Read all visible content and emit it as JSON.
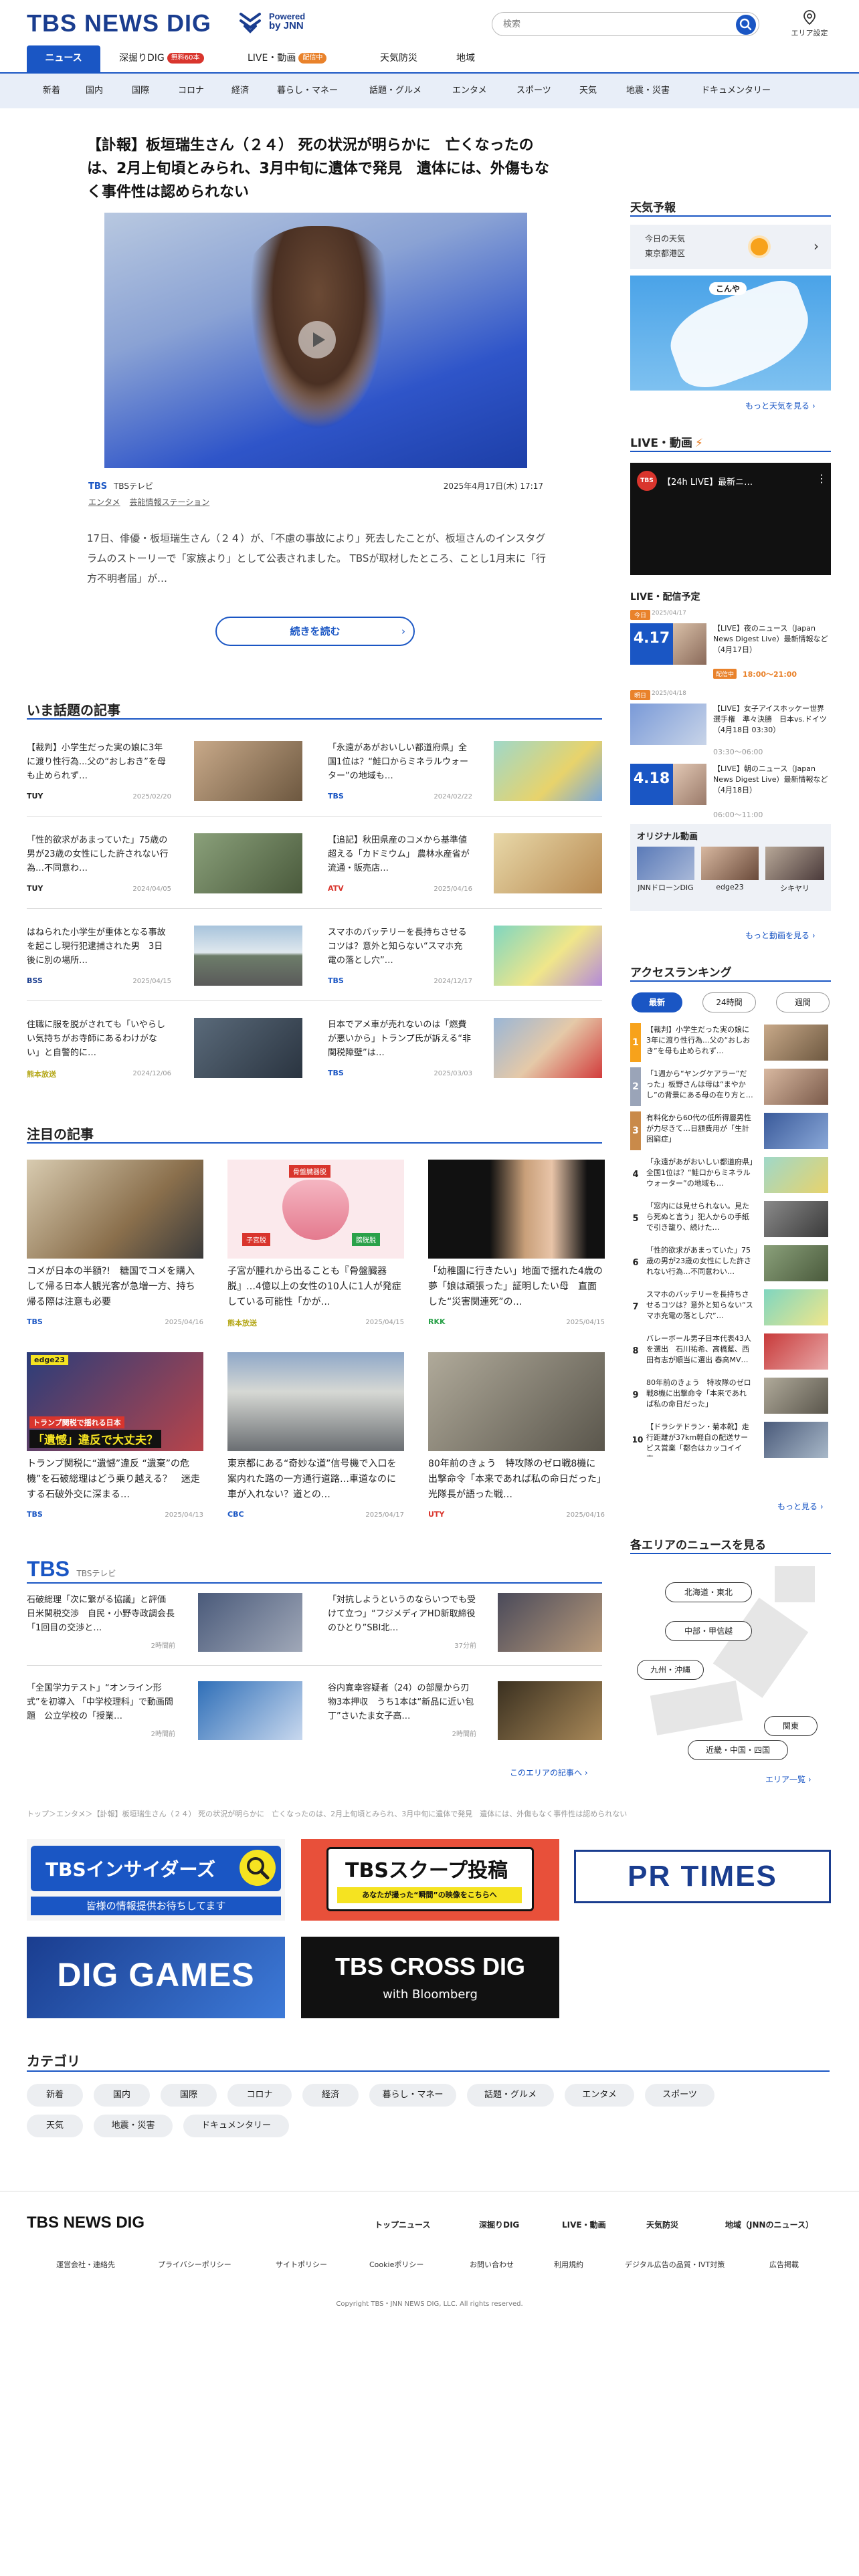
{
  "header": {
    "logo": "TBS NEWS DIG",
    "powered_line1": "Powered",
    "powered_line2": "by JNN",
    "search_placeholder": "検索",
    "area_setting": "エリア設定"
  },
  "nav": {
    "items": [
      {
        "label": "ニュース",
        "badge": ""
      },
      {
        "label": "深掘りDIG",
        "badge": "無料60本"
      },
      {
        "label": "LIVE・動画",
        "badge": "配信中"
      },
      {
        "label": "天気防災",
        "badge": ""
      },
      {
        "label": "地域",
        "badge": ""
      }
    ],
    "badge_colors": {
      "dig": "#d9352d",
      "live": "#e9822b"
    }
  },
  "subnav": [
    "新着",
    "国内",
    "国際",
    "コロナ",
    "経済",
    "暮らし・マネー",
    "話題・グルメ",
    "エンタメ",
    "スポーツ",
    "天気",
    "地震・災害",
    "ドキュメンタリー"
  ],
  "lead": {
    "title": "【訃報】板垣瑞生さん（２４） 死の状況が明らかに　亡くなったのは、2月上旬頃とみられ、3月中旬に遺体で発見　遺体には、外傷もなく事件性は認められない",
    "source_logo": "TBS",
    "source": "TBSテレビ",
    "timestamp": "2025年4月17日(木) 17:17",
    "tag1": "エンタメ",
    "tag2": "芸能情報ステーション",
    "summary": "17日、俳優・板垣瑞生さん（２４）が、「不慮の事故により」死去したことが、板垣さんのインスタグラムのストーリーで「家族より」として公表されました。 TBSが取材したところ、ことし1月末に「行方不明者届」が…",
    "more_label": "続きを読む"
  },
  "topics": {
    "heading": "いま話題の記事",
    "items": [
      {
        "text": "【裁判】小学生だった実の娘に3年に渡り性行為...父の“おしおき”を母も止められず…",
        "source": "TUY",
        "date": "2025/02/20",
        "color": "#222"
      },
      {
        "text": "「永遠があがおいしい都道府県」全国1位は？“鮭口からミネラルウォーター”の地域も…",
        "source": "TBS",
        "date": "2024/02/22",
        "color": "#1a56c4"
      },
      {
        "text": "「性的欲求があまっていた」75歳の男が23歳の女性にした許されない行為…不同意わ…",
        "source": "TUY",
        "date": "2024/04/05",
        "color": "#222"
      },
      {
        "text": "【追記】秋田県産のコメから基準値超える「カドミウム」 農林水産省が流通・販売店…",
        "source": "ATV",
        "date": "2025/04/16",
        "color": "#d9352d"
      },
      {
        "text": "はねられた小学生が重体となる事故を起こし現行犯逮捕された男　3日後に別の場所…",
        "source": "BSS",
        "date": "2025/04/15",
        "color": "#1a3d8f"
      },
      {
        "text": "スマホのバッテリーを長持ちさせるコツは？意外と知らない“スマホ充電の落とし穴”…",
        "source": "TBS",
        "date": "2024/12/17",
        "color": "#1a56c4"
      },
      {
        "text": "住職に服を脱がされても「いやらしい気持ちがお寺師にあるわけがない」と自警的に…",
        "source": "熊本放送",
        "date": "2024/12/06",
        "color": "#b5a81a"
      },
      {
        "text": "日本でアメ車が売れないのは「燃費が悪いから」トランプ氏が訴える“非関税障壁”は…",
        "source": "TBS",
        "date": "2025/03/03",
        "color": "#1a56c4"
      }
    ]
  },
  "featured": {
    "heading": "注目の記事",
    "items": [
      {
        "text": "コメが日本の半額?!　糖国でコメを購入して帰る日本人観光客が急増一方、持ち帰る際は注意も必要",
        "source": "TBS",
        "date": "2025/04/16",
        "color": "#1a56c4"
      },
      {
        "text": "子宮が腫れから出ることも『骨盤臓器脱』…4億以上の女性の10人に1人が発症している可能性「かが…",
        "source": "熊本放送",
        "date": "2025/04/15",
        "color": "#b5a81a"
      },
      {
        "text": "「幼稚園に行きたい」地面で揺れた4歳の夢「娘は頑張った」証明したい母　直面した“災害関連死”の…",
        "source": "RKK",
        "date": "2025/04/15",
        "color": "#2aa14a"
      },
      {
        "text": "トランプ関税に“遺憾”違反 “遺棄”の危機”を石破総理はどう乗り越える？　迷走する石破外交に深まる…",
        "source": "TBS",
        "date": "2025/04/13",
        "color": "#1a56c4"
      },
      {
        "text": "東京都にある“奇妙な道”信号機で入口を案内れた路の一方通行道路…車道なのに車が入れない？道との…",
        "source": "CBC",
        "date": "2025/04/17",
        "color": "#1a56c4"
      },
      {
        "text": "80年前のきょう　特攻隊のゼロ戦8機に出撃命令「本来であれば私の命日だった」光隊長が語った戦…",
        "source": "UTY",
        "date": "2025/04/16",
        "color": "#d9352d"
      }
    ],
    "overlay1": "edge23",
    "overlay2": "トランプ関税で揺れる日本",
    "overlay3": "「遺憾」違反で大丈夫？",
    "overlay4": "子宮脱",
    "overlay5": "膀胱脱",
    "overlay6": "骨盤臓器脱"
  },
  "tbs_block": {
    "heading_logo": "TBS",
    "heading_sub": "TBSテレビ",
    "items": [
      {
        "text": "石破総理「次に繋がる協議」と評価　日米関税交渉　自民・小野寺政調会長「1回目の交渉と…",
        "date": "2時間前"
      },
      {
        "text": "「対抗しようというのならいつでも受けて立つ」“フジメディアHD新取締役のひとり”SBI北…",
        "date": "37分前"
      },
      {
        "text": "「全国学力テスト」“オンライン形式”を初導入 「中学校理科」で動画問題　公立学校の「授業…",
        "date": "2時間前"
      },
      {
        "text": "谷内寛幸容疑者（24）の部屋から刃物3本押収　うち1本は“新品に近い包丁”さいたま女子高…",
        "date": "2時間前"
      }
    ],
    "more": "このエリアの記事へ"
  },
  "breadcrumb": "トップ＞エンタメ＞【訃報】板垣瑞生さん（２４） 死の状況が明らかに　亡くなったのは、2月上旬頃とみられ、3月中旬に遺体で発見　遺体には、外傷もなく事件性は認められない",
  "banners": {
    "insiders_title": "TBSインサイダーズ",
    "insiders_sub": "皆様の情報提供お待ちしてます",
    "scoop_title": "TBSスクープ投稿",
    "scoop_sub": "あなたが撮った“瞬間”の映像をこちらへ",
    "prtimes": "PR TIMES",
    "diggames": "DIG GAMES",
    "crossdig": "TBS CROSS DIG",
    "crossdig_sub": "with Bloomberg"
  },
  "categories": {
    "heading": "カテゴリ",
    "items": [
      "新着",
      "国内",
      "国際",
      "コロナ",
      "経済",
      "暮らし・マネー",
      "話題・グルメ",
      "エンタメ",
      "スポーツ",
      "天気",
      "地震・災害",
      "ドキュメンタリー"
    ]
  },
  "sidebar": {
    "weather": {
      "heading": "天気予報",
      "label1": "今日の天気",
      "label2": "東京都港区",
      "map_tag": "こんや",
      "more": "もっと天気を見る"
    },
    "live": {
      "heading": "LIVE・動画",
      "video_title": "【24h LIVE】最新ニ…",
      "schedule_heading": "LIVE・配信予定",
      "items": [
        {
          "date_tag": "2025/04/17",
          "day": "4.17",
          "dow": "木",
          "text": "【LIVE】夜のニュース（Japan News Digest Live）最新情報など（4月17日）",
          "time": "18:00～21:00",
          "badge": "配信中",
          "tag": "#e9822b"
        },
        {
          "date_tag": "2025/04/18",
          "day": "",
          "dow": "",
          "text": "【LIVE】女子アイスホッケー世界選手権　準々決勝　日本vs.ドイツ（4月18日 03:30）",
          "time": "03:30～06:00",
          "badge": "",
          "tag": "#e9822b"
        },
        {
          "date_tag": "",
          "day": "4.18",
          "dow": "金",
          "text": "【LIVE】朝のニュース（Japan News Digest Live）最新情報など（4月18日）",
          "time": "06:00～11:00",
          "badge": "",
          "tag": "#e9822b"
        }
      ],
      "original_heading": "オリジナル動画",
      "original_items": [
        "JNNドローンDIG",
        "edge23",
        "シキヤリ"
      ],
      "more": "もっと動画を見る"
    },
    "ranking": {
      "heading": "アクセスランキング",
      "tabs": [
        "最新",
        "24時間",
        "週間"
      ],
      "items": [
        "【裁判】小学生だった実の娘に3年に渡り性行為...父の“おしおき”を母も止められず…",
        "「1週から“ヤングケアラー”だった」板野さんは母は“まやかし”の背景にある母の在り方と…",
        "有料化から60代の低所得層男性が力尽きて…日額費用が「生計困窮症」",
        "「永遠があがおいしい都道府県」全国1位は？“鮭口からミネラルウォーター”の地域も…",
        "「窓内には見せられない。見たら死ぬと言う」犯人からの手紙で引き籠り、続けた…",
        "「性的欲求があまっていた」75歳の男が23歳の女性にした許されない行為…不同意わい…",
        "スマホのバッテリーを長持ちさせるコツは？意外と知らない“スマホ充電の落とし穴”…",
        "バレーボール男子日本代表43人を選出　石川祐希、高橋藍、西田有志が順当に選出 春高MV…",
        "80年前のきょう　特攻隊のゼロ戦8機に出撃命令「本来であれば私の命日だった」",
        "【ドラシテドラン・菊本靴】走行距離が37km軽自の配送サービス営業「都合はカッコイイ車…"
      ],
      "more": "もっと見る"
    },
    "area": {
      "heading": "各エリアのニュースを見る",
      "regions": [
        "北海道・東北",
        "中部・甲信越",
        "九州・沖縄",
        "関東",
        "近畿・中国・四国"
      ],
      "more": "エリア一覧"
    }
  },
  "footer": {
    "logo": "TBS NEWS DIG",
    "links": [
      "トップニュース",
      "深掘りDIG",
      "LIVE・動画",
      "天気防災",
      "地域（JNNのニュース）"
    ],
    "small_links": [
      "運営会社・連絡先",
      "プライバシーポリシー",
      "サイトポリシー",
      "Cookieポリシー",
      "お問い合わせ",
      "利用規約",
      "デジタル広告の品質・IVT対策",
      "広告掲載"
    ],
    "copyright": "Copyright TBS・JNN NEWS DIG, LLC. All rights reserved."
  }
}
